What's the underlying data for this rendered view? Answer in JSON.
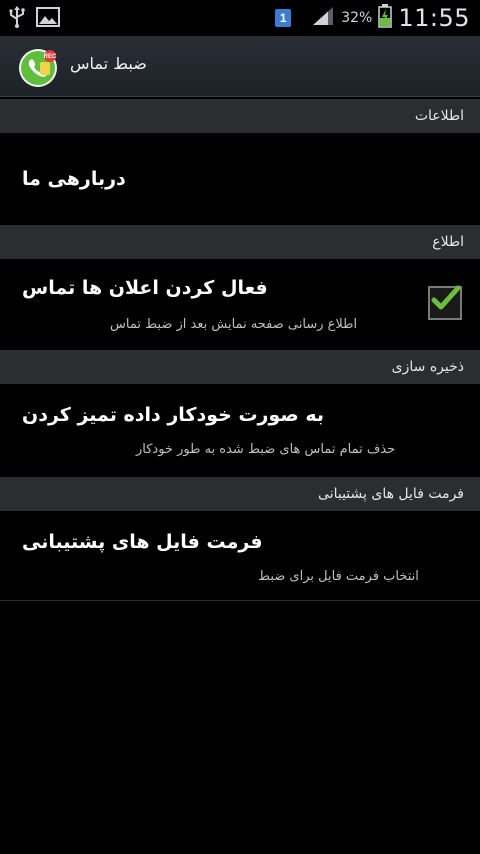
{
  "status_bar": {
    "sim_slot": "1",
    "battery_percent": "32%",
    "time": "11:55",
    "icons": [
      "usb-icon",
      "image-icon",
      "sim-card-icon",
      "signal-icon",
      "battery-charging-icon"
    ]
  },
  "app": {
    "title": "ضبط تماس",
    "icon": "call-recorder-app-icon"
  },
  "sections": [
    {
      "header": "اطلاعات",
      "items": [
        {
          "title": "دربارهی ما"
        }
      ]
    },
    {
      "header": "اطلاع",
      "items": [
        {
          "title": "فعال کردن اعلان ها تماس",
          "summary": "اطلاع رسانی صفحه نمایش بعد از ضبط تماس",
          "checked": true
        }
      ]
    },
    {
      "header": "ذخیره سازی",
      "items": [
        {
          "title": "به صورت خودکار داده تمیز کردن",
          "summary": "حذف تمام تماس های ضبط شده به طور خودکار"
        }
      ]
    },
    {
      "header": "فرمت فایل های پشتیبانی",
      "items": [
        {
          "title": "فرمت فایل های پشتیبانی",
          "summary": "انتخاب فرمت فایل برای ضبط"
        }
      ]
    }
  ],
  "colors": {
    "checkmark": "#6abf3a",
    "header_bg": "#2b2d31",
    "actionbar_bg": "#23272e"
  }
}
